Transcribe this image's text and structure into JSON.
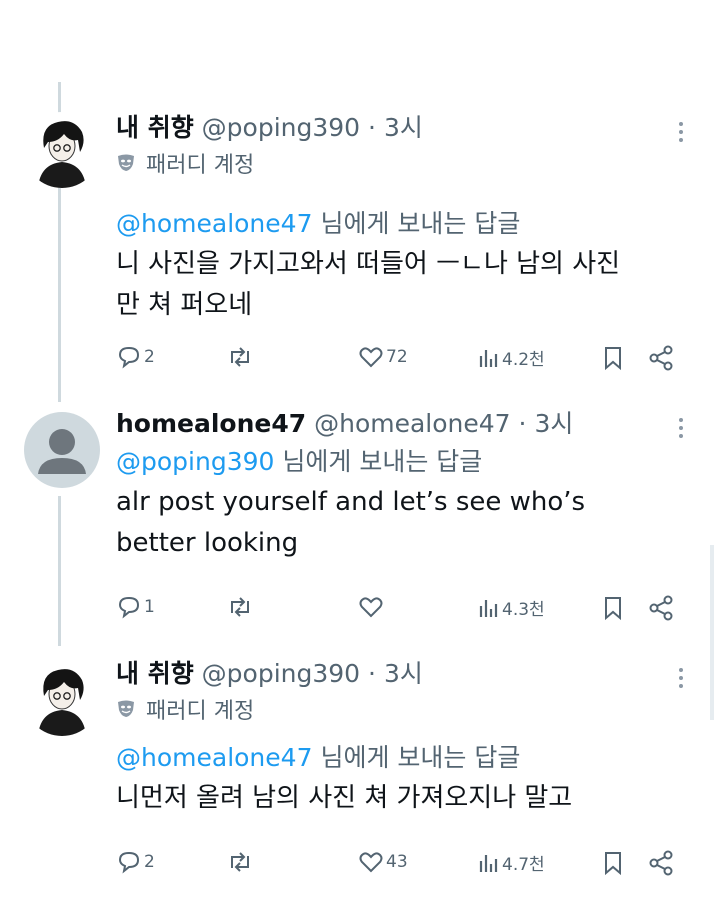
{
  "posts": [
    {
      "author": "내 취향",
      "handle": "@poping390",
      "separator": "·",
      "time": "3시",
      "badge": "패러디 계정",
      "reply_to": "@homealone47",
      "reply_suffix": "님에게 보내는 답글",
      "text": "니 사진을 가지고와서 떠들어 ㅡㄴ나 남의 사진만 쳐 퍼오네",
      "replies": "2",
      "reposts": "",
      "likes": "72",
      "views": "4.2천"
    },
    {
      "author": "homealone47",
      "handle": "@homealone47",
      "separator": "·",
      "time": "3시",
      "reply_to": "@poping390",
      "reply_suffix": "님에게 보내는 답글",
      "text": "alr post yourself and let’s see who’s better looking",
      "replies": "1",
      "reposts": "",
      "likes": "",
      "views": "4.3천"
    },
    {
      "author": "내 취향",
      "handle": "@poping390",
      "separator": "·",
      "time": "3시",
      "badge": "패러디 계정",
      "reply_to": "@homealone47",
      "reply_suffix": "님에게 보내는 답글",
      "text": "니먼저 올려 남의 사진 쳐 가져오지나 말고",
      "replies": "2",
      "reposts": "",
      "likes": "43",
      "views": "4.7천"
    }
  ],
  "icons": {
    "reply": "speech-bubble-icon",
    "repost": "repost-arrows-icon",
    "like": "heart-icon",
    "views": "bar-chart-icon",
    "bookmark": "bookmark-icon",
    "share": "share-icon",
    "more": "more-vertical-icon",
    "parody": "theater-mask-icon"
  },
  "colors": {
    "link": "#1d9bf0",
    "muted": "#536471",
    "text": "#0f1419",
    "thread_line": "#cfd9de"
  }
}
